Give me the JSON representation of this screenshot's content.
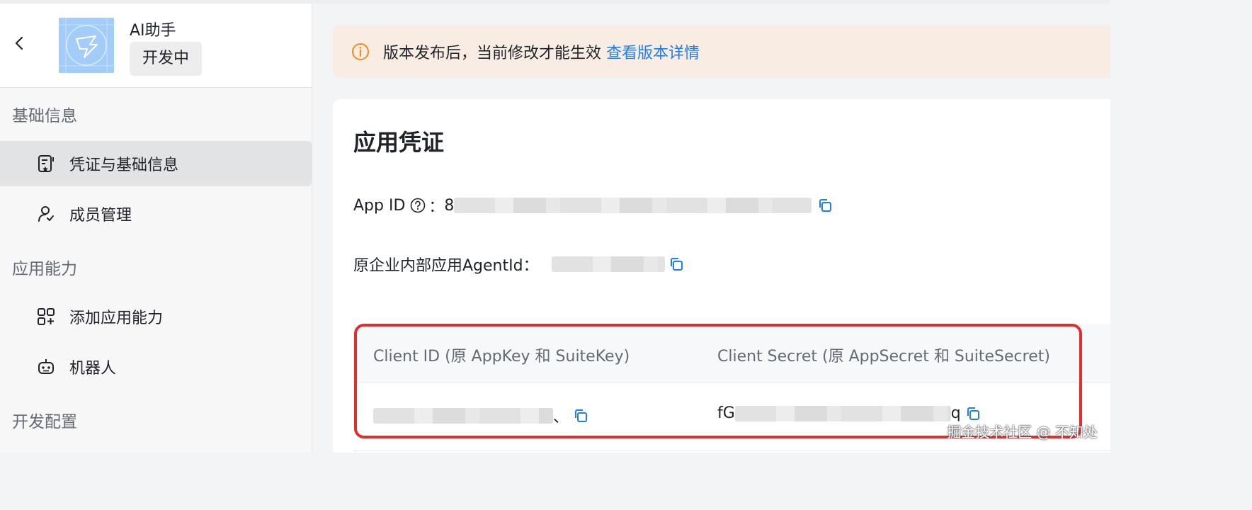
{
  "app": {
    "name": "AI助手",
    "status": "开发中"
  },
  "sidebar": {
    "groups": [
      {
        "title": "基础信息",
        "items": [
          {
            "label": "凭证与基础信息",
            "icon": "credential-icon",
            "active": true
          },
          {
            "label": "成员管理",
            "icon": "member-icon",
            "active": false
          }
        ]
      },
      {
        "title": "应用能力",
        "items": [
          {
            "label": "添加应用能力",
            "icon": "add-capability-icon",
            "active": false
          },
          {
            "label": "机器人",
            "icon": "robot-icon",
            "active": false
          }
        ]
      },
      {
        "title": "开发配置",
        "items": []
      }
    ]
  },
  "notice": {
    "icon": "info-icon",
    "text": "版本发布后，当前修改才能生效",
    "link": "查看版本详情"
  },
  "credentials": {
    "title": "应用凭证",
    "app_id": {
      "label": "App ID",
      "separator": "：",
      "value_prefix": "8"
    },
    "agent_id": {
      "label": "原企业内部应用AgentId："
    },
    "table": {
      "headers": [
        "Client ID (原 AppKey 和 SuiteKey)",
        "Client Secret (原 AppSecret 和 SuiteSecret)"
      ],
      "client_id_suffix": "、",
      "client_secret_prefix": "fG",
      "client_secret_suffix": "q"
    }
  },
  "watermark": "掘金技术社区 @ 不知处",
  "colors": {
    "accent": "#1d7df2",
    "warning": "#f08c1c",
    "highlight": "#e22d2d",
    "logo_bg": "#a3cdf8"
  }
}
